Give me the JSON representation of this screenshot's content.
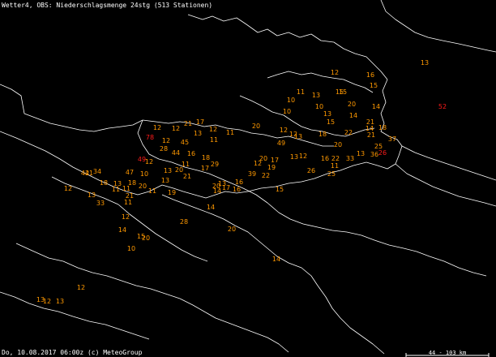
{
  "title": "Wetter4, OBS: Niederschlagsmenge 24stg (513 Stationen)",
  "footer": "Do, 10.08.2017 06:00z (c) MeteoGroup",
  "scale_label": "44 - 103 km",
  "colors": {
    "background": "#000000",
    "border": "#ffffff",
    "value_normal": "#ff9900",
    "value_high": "#ff1a1a",
    "scale_bar": "#ffffff"
  },
  "stations": [
    {
      "value": "13",
      "level": "normal"
    },
    {
      "value": "12",
      "level": "normal"
    },
    {
      "value": "16",
      "level": "normal"
    },
    {
      "value": "15",
      "level": "normal"
    },
    {
      "value": "52",
      "level": "high"
    },
    {
      "value": "11",
      "level": "normal"
    },
    {
      "value": "13",
      "level": "normal"
    },
    {
      "value": "10",
      "level": "normal"
    },
    {
      "value": "10",
      "level": "normal"
    },
    {
      "value": "10",
      "level": "normal"
    },
    {
      "value": "15",
      "level": "normal"
    },
    {
      "value": "15",
      "level": "normal"
    },
    {
      "value": "20",
      "level": "normal"
    },
    {
      "value": "14",
      "level": "normal"
    },
    {
      "value": "13",
      "level": "normal"
    },
    {
      "value": "14",
      "level": "normal"
    },
    {
      "value": "15",
      "level": "normal"
    },
    {
      "value": "21",
      "level": "normal"
    },
    {
      "value": "18",
      "level": "normal"
    },
    {
      "value": "12",
      "level": "normal"
    },
    {
      "value": "12",
      "level": "normal"
    },
    {
      "value": "21",
      "level": "normal"
    },
    {
      "value": "17",
      "level": "normal"
    },
    {
      "value": "12",
      "level": "normal"
    },
    {
      "value": "11",
      "level": "normal"
    },
    {
      "value": "20",
      "level": "normal"
    },
    {
      "value": "12",
      "level": "normal"
    },
    {
      "value": "12",
      "level": "normal"
    },
    {
      "value": "13",
      "level": "normal"
    },
    {
      "value": "18",
      "level": "normal"
    },
    {
      "value": "22",
      "level": "normal"
    },
    {
      "value": "14",
      "level": "normal"
    },
    {
      "value": "21",
      "level": "normal"
    },
    {
      "value": "37",
      "level": "normal"
    },
    {
      "value": "78",
      "level": "high"
    },
    {
      "value": "12",
      "level": "normal"
    },
    {
      "value": "45",
      "level": "normal"
    },
    {
      "value": "13",
      "level": "normal"
    },
    {
      "value": "11",
      "level": "normal"
    },
    {
      "value": "49",
      "level": "normal"
    },
    {
      "value": "20",
      "level": "normal"
    },
    {
      "value": "25",
      "level": "normal"
    },
    {
      "value": "26",
      "level": "high"
    },
    {
      "value": "28",
      "level": "normal"
    },
    {
      "value": "44",
      "level": "normal"
    },
    {
      "value": "16",
      "level": "normal"
    },
    {
      "value": "18",
      "level": "normal"
    },
    {
      "value": "13",
      "level": "normal"
    },
    {
      "value": "36",
      "level": "normal"
    },
    {
      "value": "49",
      "level": "high"
    },
    {
      "value": "12",
      "level": "normal"
    },
    {
      "value": "29",
      "level": "normal"
    },
    {
      "value": "20",
      "level": "normal"
    },
    {
      "value": "17",
      "level": "normal"
    },
    {
      "value": "13",
      "level": "normal"
    },
    {
      "value": "12",
      "level": "normal"
    },
    {
      "value": "16",
      "level": "normal"
    },
    {
      "value": "22",
      "level": "normal"
    },
    {
      "value": "33",
      "level": "normal"
    },
    {
      "value": "42",
      "level": "normal"
    },
    {
      "value": "34",
      "level": "normal"
    },
    {
      "value": "47",
      "level": "normal"
    },
    {
      "value": "10",
      "level": "normal"
    },
    {
      "value": "13",
      "level": "normal"
    },
    {
      "value": "20",
      "level": "normal"
    },
    {
      "value": "11",
      "level": "normal"
    },
    {
      "value": "17",
      "level": "normal"
    },
    {
      "value": "12",
      "level": "normal"
    },
    {
      "value": "19",
      "level": "normal"
    },
    {
      "value": "11",
      "level": "normal"
    },
    {
      "value": "26",
      "level": "normal"
    },
    {
      "value": "25",
      "level": "normal"
    },
    {
      "value": "41",
      "level": "normal"
    },
    {
      "value": "18",
      "level": "normal"
    },
    {
      "value": "13",
      "level": "normal"
    },
    {
      "value": "18",
      "level": "normal"
    },
    {
      "value": "13",
      "level": "normal"
    },
    {
      "value": "21",
      "level": "normal"
    },
    {
      "value": "20",
      "level": "normal"
    },
    {
      "value": "13",
      "level": "normal"
    },
    {
      "value": "39",
      "level": "normal"
    },
    {
      "value": "22",
      "level": "normal"
    },
    {
      "value": "16",
      "level": "normal"
    },
    {
      "value": "12",
      "level": "normal"
    },
    {
      "value": "13",
      "level": "normal"
    },
    {
      "value": "11",
      "level": "normal"
    },
    {
      "value": "11",
      "level": "normal"
    },
    {
      "value": "20",
      "level": "normal"
    },
    {
      "value": "17",
      "level": "normal"
    },
    {
      "value": "16",
      "level": "normal"
    },
    {
      "value": "11",
      "level": "normal"
    },
    {
      "value": "19",
      "level": "normal"
    },
    {
      "value": "21",
      "level": "normal"
    },
    {
      "value": "15",
      "level": "normal"
    },
    {
      "value": "33",
      "level": "normal"
    },
    {
      "value": "11",
      "level": "normal"
    },
    {
      "value": "14",
      "level": "normal"
    },
    {
      "value": "14",
      "level": "normal"
    },
    {
      "value": "12",
      "level": "normal"
    },
    {
      "value": "28",
      "level": "normal"
    },
    {
      "value": "14",
      "level": "normal"
    },
    {
      "value": "20",
      "level": "normal"
    },
    {
      "value": "15",
      "level": "normal"
    },
    {
      "value": "20",
      "level": "normal"
    },
    {
      "value": "10",
      "level": "normal"
    },
    {
      "value": "14",
      "level": "normal"
    },
    {
      "value": "12",
      "level": "normal"
    },
    {
      "value": "13",
      "level": "normal"
    },
    {
      "value": "12",
      "level": "normal"
    },
    {
      "value": "13",
      "level": "normal"
    }
  ]
}
